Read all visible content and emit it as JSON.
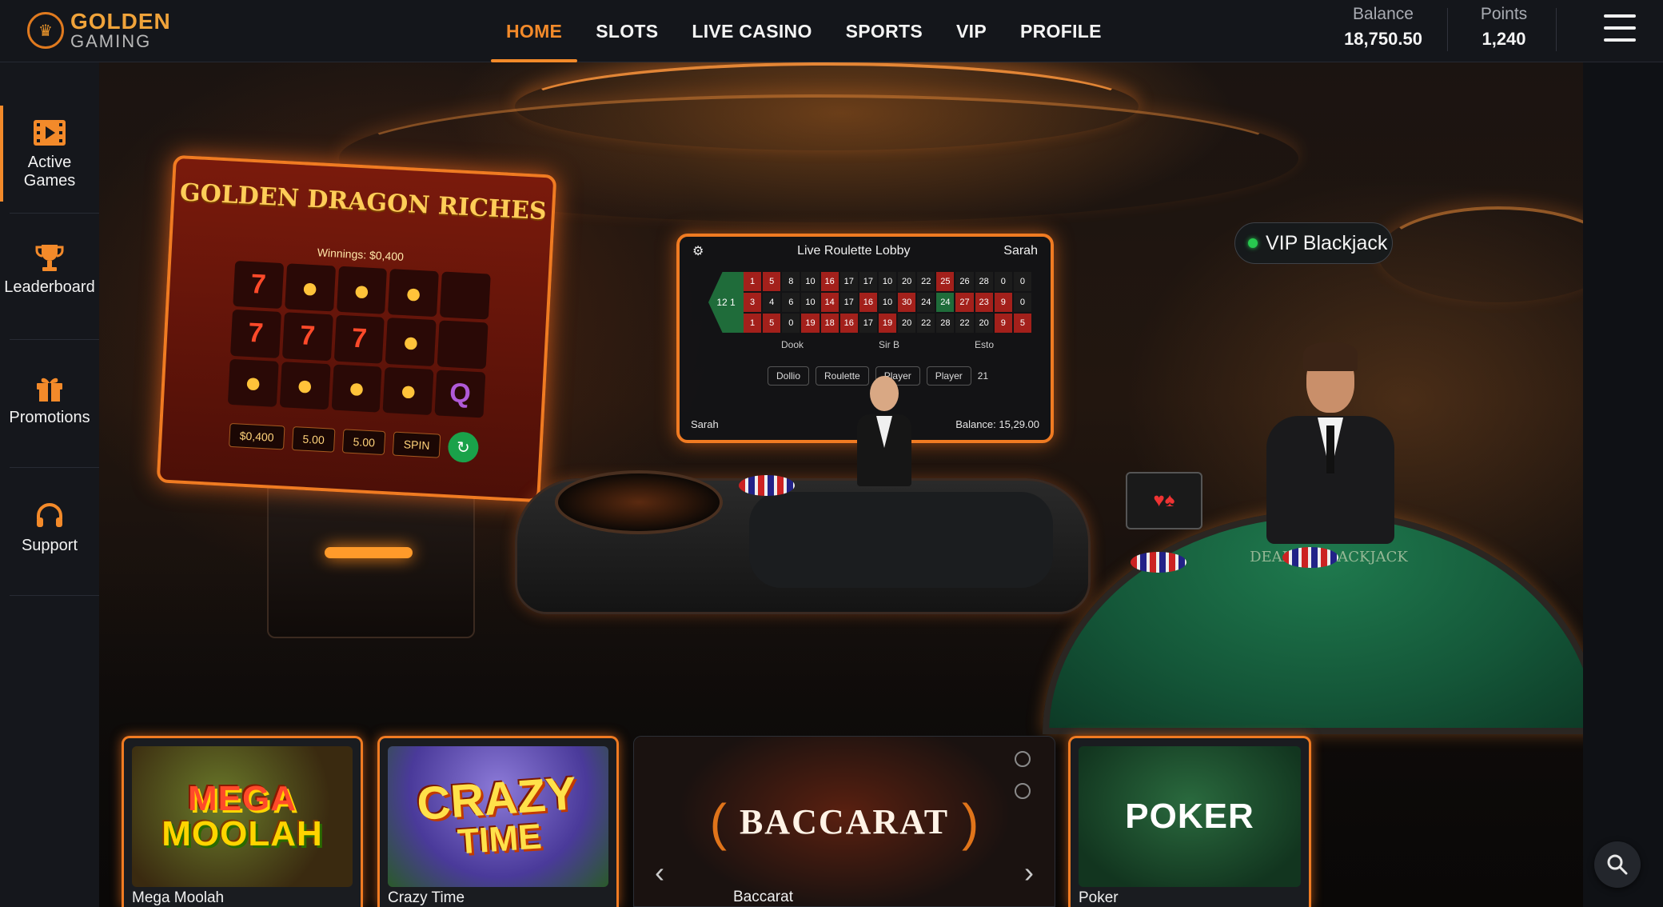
{
  "brand": {
    "name_line1": "GOLDEN",
    "name_line2": "GAMING"
  },
  "nav": {
    "items": [
      {
        "label": "HOME",
        "active": true
      },
      {
        "label": "SLOTS",
        "active": false
      },
      {
        "label": "LIVE CASINO",
        "active": false
      },
      {
        "label": "SPORTS",
        "active": false
      },
      {
        "label": "VIP",
        "active": false
      },
      {
        "label": "PROFILE",
        "active": false
      }
    ]
  },
  "account": {
    "balance_label": "Balance",
    "balance_value": "18,750.50",
    "points_label": "Points",
    "points_value": "1,240"
  },
  "sidebar": {
    "items": [
      {
        "label": "Active Games",
        "icon": "film-play-icon",
        "active": true
      },
      {
        "label": "Leaderboard",
        "icon": "trophy-icon",
        "active": false
      },
      {
        "label": "Promotions",
        "icon": "gift-icon",
        "active": false
      },
      {
        "label": "Support",
        "icon": "headset-icon",
        "active": false
      }
    ]
  },
  "hero": {
    "slot": {
      "title": "GOLDEN DRAGON RICHES",
      "winnings": "Winnings: $0,400",
      "field_winnings": "$0,400",
      "field_bet": "5.00",
      "field_total": "5.00",
      "spin_label": "SPIN",
      "reels": [
        "7",
        "●",
        "●",
        "●",
        "",
        "7",
        "7",
        "7",
        "●",
        "",
        "●",
        "●",
        "●",
        "●",
        "Q"
      ]
    },
    "roulette": {
      "title": "Live Roulette Lobby",
      "user": "Sarah",
      "zero": "12 1",
      "rows": [
        [
          "1",
          "5",
          "8",
          "10",
          "16",
          "17",
          "17",
          "10",
          "20",
          "22",
          "25",
          "26",
          "28",
          "0",
          "0"
        ],
        [
          "3",
          "4",
          "6",
          "10",
          "14",
          "17",
          "16",
          "10",
          "30",
          "24",
          "24",
          "27",
          "23",
          "9",
          "0"
        ],
        [
          "1",
          "5",
          "0",
          "19",
          "18",
          "16",
          "17",
          "19",
          "20",
          "22",
          "28",
          "22",
          "20",
          "9",
          "5"
        ]
      ],
      "row2": [
        "Dook",
        "Sir B",
        "Esto"
      ],
      "row3": [
        "Dollio",
        "Player",
        "21"
      ],
      "row3b": [
        "Roulette",
        "Player"
      ],
      "footer_user": "Sarah",
      "footer_balance": "Balance: 15,29.00"
    },
    "vip_tag": "VIP Blackjack",
    "bj_text": "DEALER BLACKJACK"
  },
  "games": [
    {
      "label": "Mega Moolah",
      "art_line1": "MEGA",
      "art_line2": "MOOLAH"
    },
    {
      "label": "Crazy Time",
      "art_line1": "CRAZY",
      "art_line2": "TIME"
    },
    {
      "label": "Baccarat",
      "art_line1": "BACCARAT"
    },
    {
      "label": "Poker",
      "art_line1": "POKER"
    }
  ],
  "colors": {
    "accent": "#f38a2a",
    "background": "#0f1115",
    "live_dot": "#28c84f"
  }
}
